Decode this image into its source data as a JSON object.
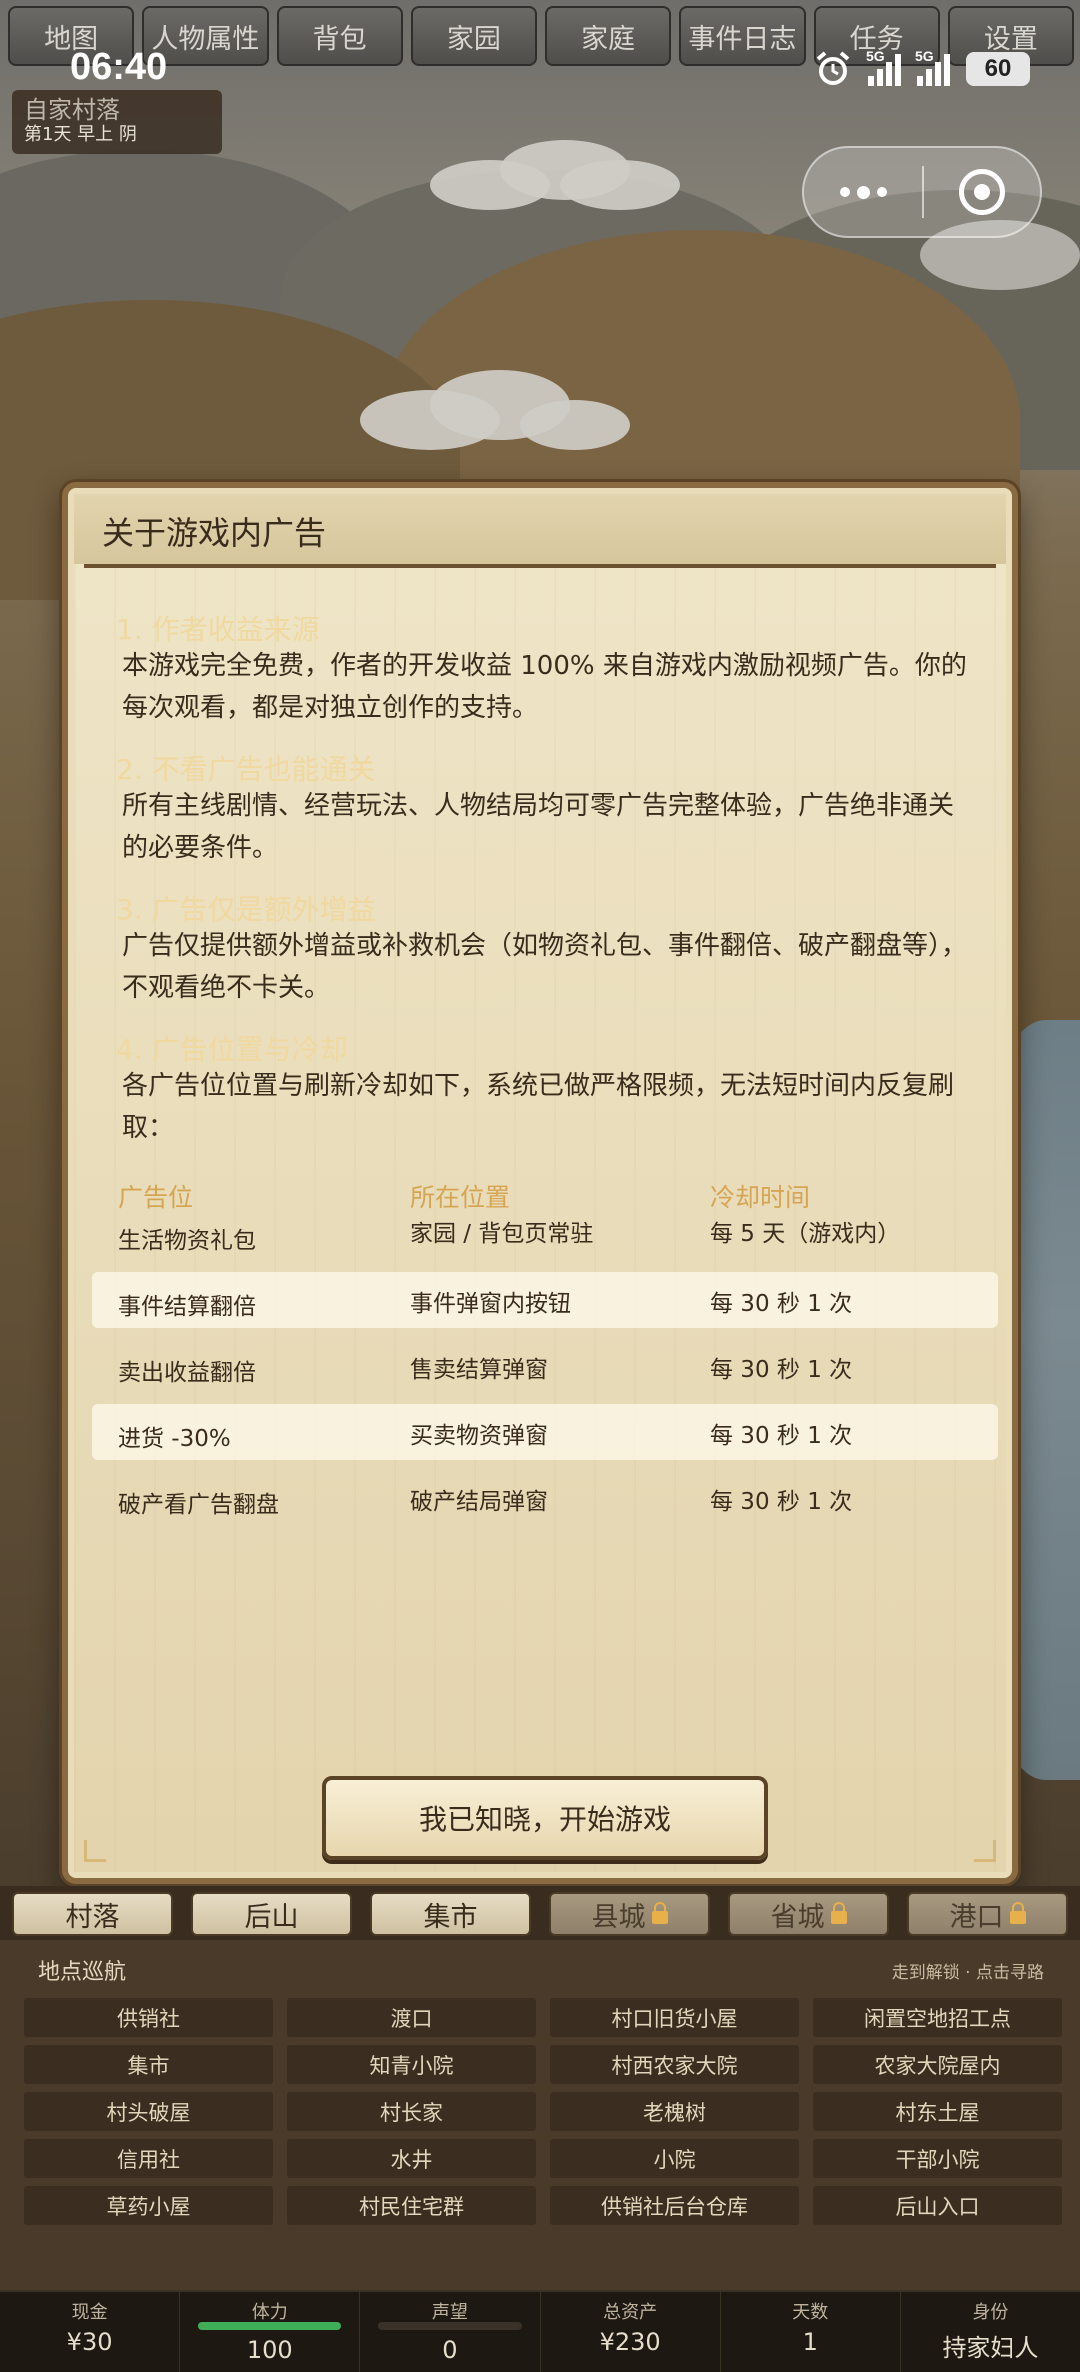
{
  "top_tabs": [
    "地图",
    "人物属性",
    "背包",
    "家园",
    "家庭",
    "事件日志",
    "任务",
    "设置"
  ],
  "status_bar": {
    "time": "06:40",
    "network1": "5G",
    "network2": "5G",
    "battery": "60"
  },
  "location": {
    "name": "自家村落",
    "date": "第1天 早上 阴"
  },
  "modal": {
    "title": "关于游戏内广告",
    "sections": [
      {
        "heading": "1. 作者收益来源",
        "body": "本游戏完全免费，作者的开发收益 100% 来自游戏内激励视频广告。你的每次观看，都是对独立创作的支持。"
      },
      {
        "heading": "2. 不看广告也能通关",
        "body": "所有主线剧情、经营玩法、人物结局均可零广告完整体验，广告绝非通关的必要条件。"
      },
      {
        "heading": "3. 广告仅是额外增益",
        "body": "广告仅提供额外增益或补救机会（如物资礼包、事件翻倍、破产翻盘等），不观看绝不卡关。"
      },
      {
        "heading": "4. 广告位置与冷却",
        "body": "各广告位位置与刷新冷却如下，系统已做严格限频，无法短时间内反复刷取："
      }
    ],
    "table": {
      "headers": [
        "广告位",
        "所在位置",
        "冷却时间"
      ],
      "rows": [
        [
          "生活物资礼包",
          "家园 / 背包页常驻",
          "每 5 天（游戏内）"
        ],
        [
          "事件结算翻倍",
          "事件弹窗内按钮",
          "每 30 秒 1 次"
        ],
        [
          "卖出收益翻倍",
          "售卖结算弹窗",
          "每 30 秒 1 次"
        ],
        [
          "进货 -30%",
          "买卖物资弹窗",
          "每 30 秒 1 次"
        ],
        [
          "破产看广告翻盘",
          "破产结局弹窗",
          "每 30 秒 1 次"
        ]
      ]
    },
    "confirm_button": "我已知晓，开始游戏"
  },
  "regions": [
    {
      "label": "村落",
      "locked": false
    },
    {
      "label": "后山",
      "locked": false
    },
    {
      "label": "集市",
      "locked": false
    },
    {
      "label": "县城",
      "locked": true
    },
    {
      "label": "省城",
      "locked": true
    },
    {
      "label": "港口",
      "locked": true
    }
  ],
  "navigator": {
    "title": "地点巡航",
    "hint": "走到解锁 · 点击寻路",
    "places": [
      "供销社",
      "渡口",
      "村口旧货小屋",
      "闲置空地招工点",
      "集市",
      "知青小院",
      "村西农家大院",
      "农家大院屋内",
      "村头破屋",
      "村长家",
      "老槐树",
      "村东土屋",
      "信用社",
      "水井",
      "小院",
      "干部小院",
      "草药小屋",
      "村民住宅群",
      "供销社后台仓库",
      "后山入口"
    ]
  },
  "stats": {
    "cash": {
      "label": "现金",
      "value": "¥30"
    },
    "stamina": {
      "label": "体力",
      "value": "100",
      "fill": 1.0,
      "color": "#3fae59"
    },
    "reputation": {
      "label": "声望",
      "value": "0",
      "fill": 0.0
    },
    "assets": {
      "label": "总资产",
      "value": "¥230"
    },
    "days": {
      "label": "天数",
      "value": "1"
    },
    "identity": {
      "label": "身份",
      "value": "持家妇人"
    }
  }
}
